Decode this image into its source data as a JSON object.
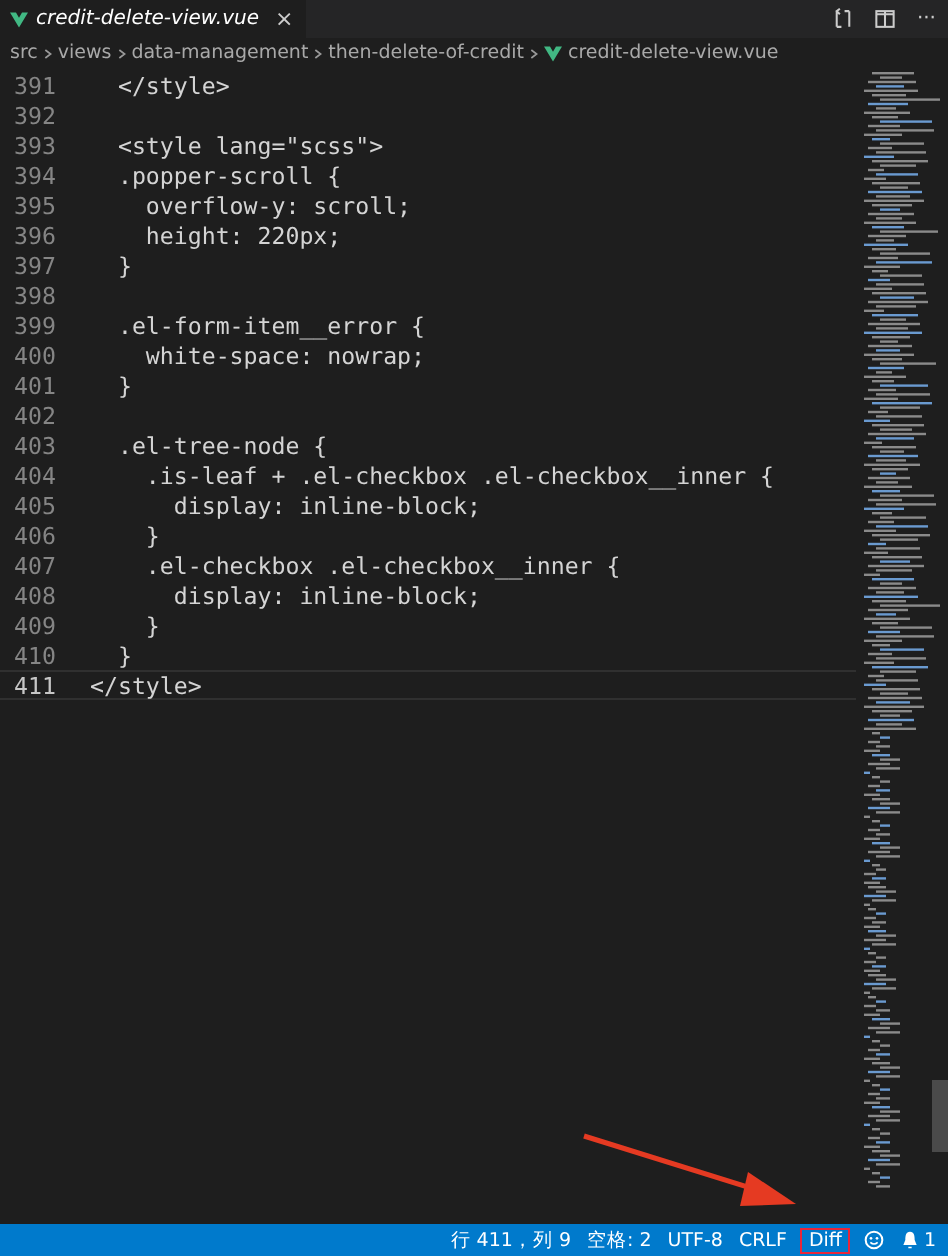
{
  "tab": {
    "label": "credit-delete-view.vue",
    "close": "×",
    "selected": true
  },
  "editor_actions": [
    {
      "kind": "compare"
    },
    {
      "kind": "split"
    },
    {
      "kind": "more",
      "label": "···"
    }
  ],
  "breadcrumb": [
    "src",
    "views",
    "data-management",
    "then-delete-of-credit",
    "credit-delete-view.vue"
  ],
  "lines": [
    {
      "number": "391",
      "text": "  </style>",
      "current": false
    },
    {
      "number": "392",
      "current": false
    },
    {
      "number": "393",
      "text": "  <style lang=\"scss\">",
      "current": false
    },
    {
      "number": "394",
      "text": "  .popper-scroll {",
      "current": false
    },
    {
      "number": "395",
      "text": "    overflow-y: scroll;",
      "current": false
    },
    {
      "number": "396",
      "text": "    height: 220px;",
      "current": false
    },
    {
      "number": "397",
      "text": "  }",
      "current": false
    },
    {
      "number": "398",
      "current": false
    },
    {
      "number": "399",
      "text": "  .el-form-item__error {",
      "current": false
    },
    {
      "number": "400",
      "text": "    white-space: nowrap;",
      "current": false
    },
    {
      "number": "401",
      "text": "  }",
      "current": false
    },
    {
      "number": "402",
      "current": false
    },
    {
      "number": "403",
      "text": "  .el-tree-node {",
      "current": false
    },
    {
      "number": "404",
      "text": "    .is-leaf + .el-checkbox .el-checkbox__inner {",
      "current": false
    },
    {
      "number": "405",
      "text": "      display: inline-block;",
      "current": false
    },
    {
      "number": "406",
      "text": "    }",
      "current": false
    },
    {
      "number": "407",
      "text": "    .el-checkbox .el-checkbox__inner {",
      "current": false
    },
    {
      "number": "408",
      "text": "      display: inline-block;",
      "current": false
    },
    {
      "number": "409",
      "text": "    }",
      "current": false
    },
    {
      "number": "410",
      "text": "  }",
      "current": false
    },
    {
      "number": "411",
      "text": "</style>",
      "current": true
    }
  ],
  "status_bar": [
    {
      "kind": "text",
      "label": "行 411，列 9",
      "highlighted": false
    },
    {
      "kind": "text",
      "label": "空格: 2",
      "highlighted": false
    },
    {
      "kind": "text",
      "label": "UTF-8",
      "highlighted": false
    },
    {
      "kind": "text",
      "label": "CRLF",
      "highlighted": false
    },
    {
      "kind": "text",
      "label": "Diff",
      "highlighted": true
    },
    {
      "kind": "feedback"
    },
    {
      "kind": "notifications",
      "label": "1"
    }
  ]
}
